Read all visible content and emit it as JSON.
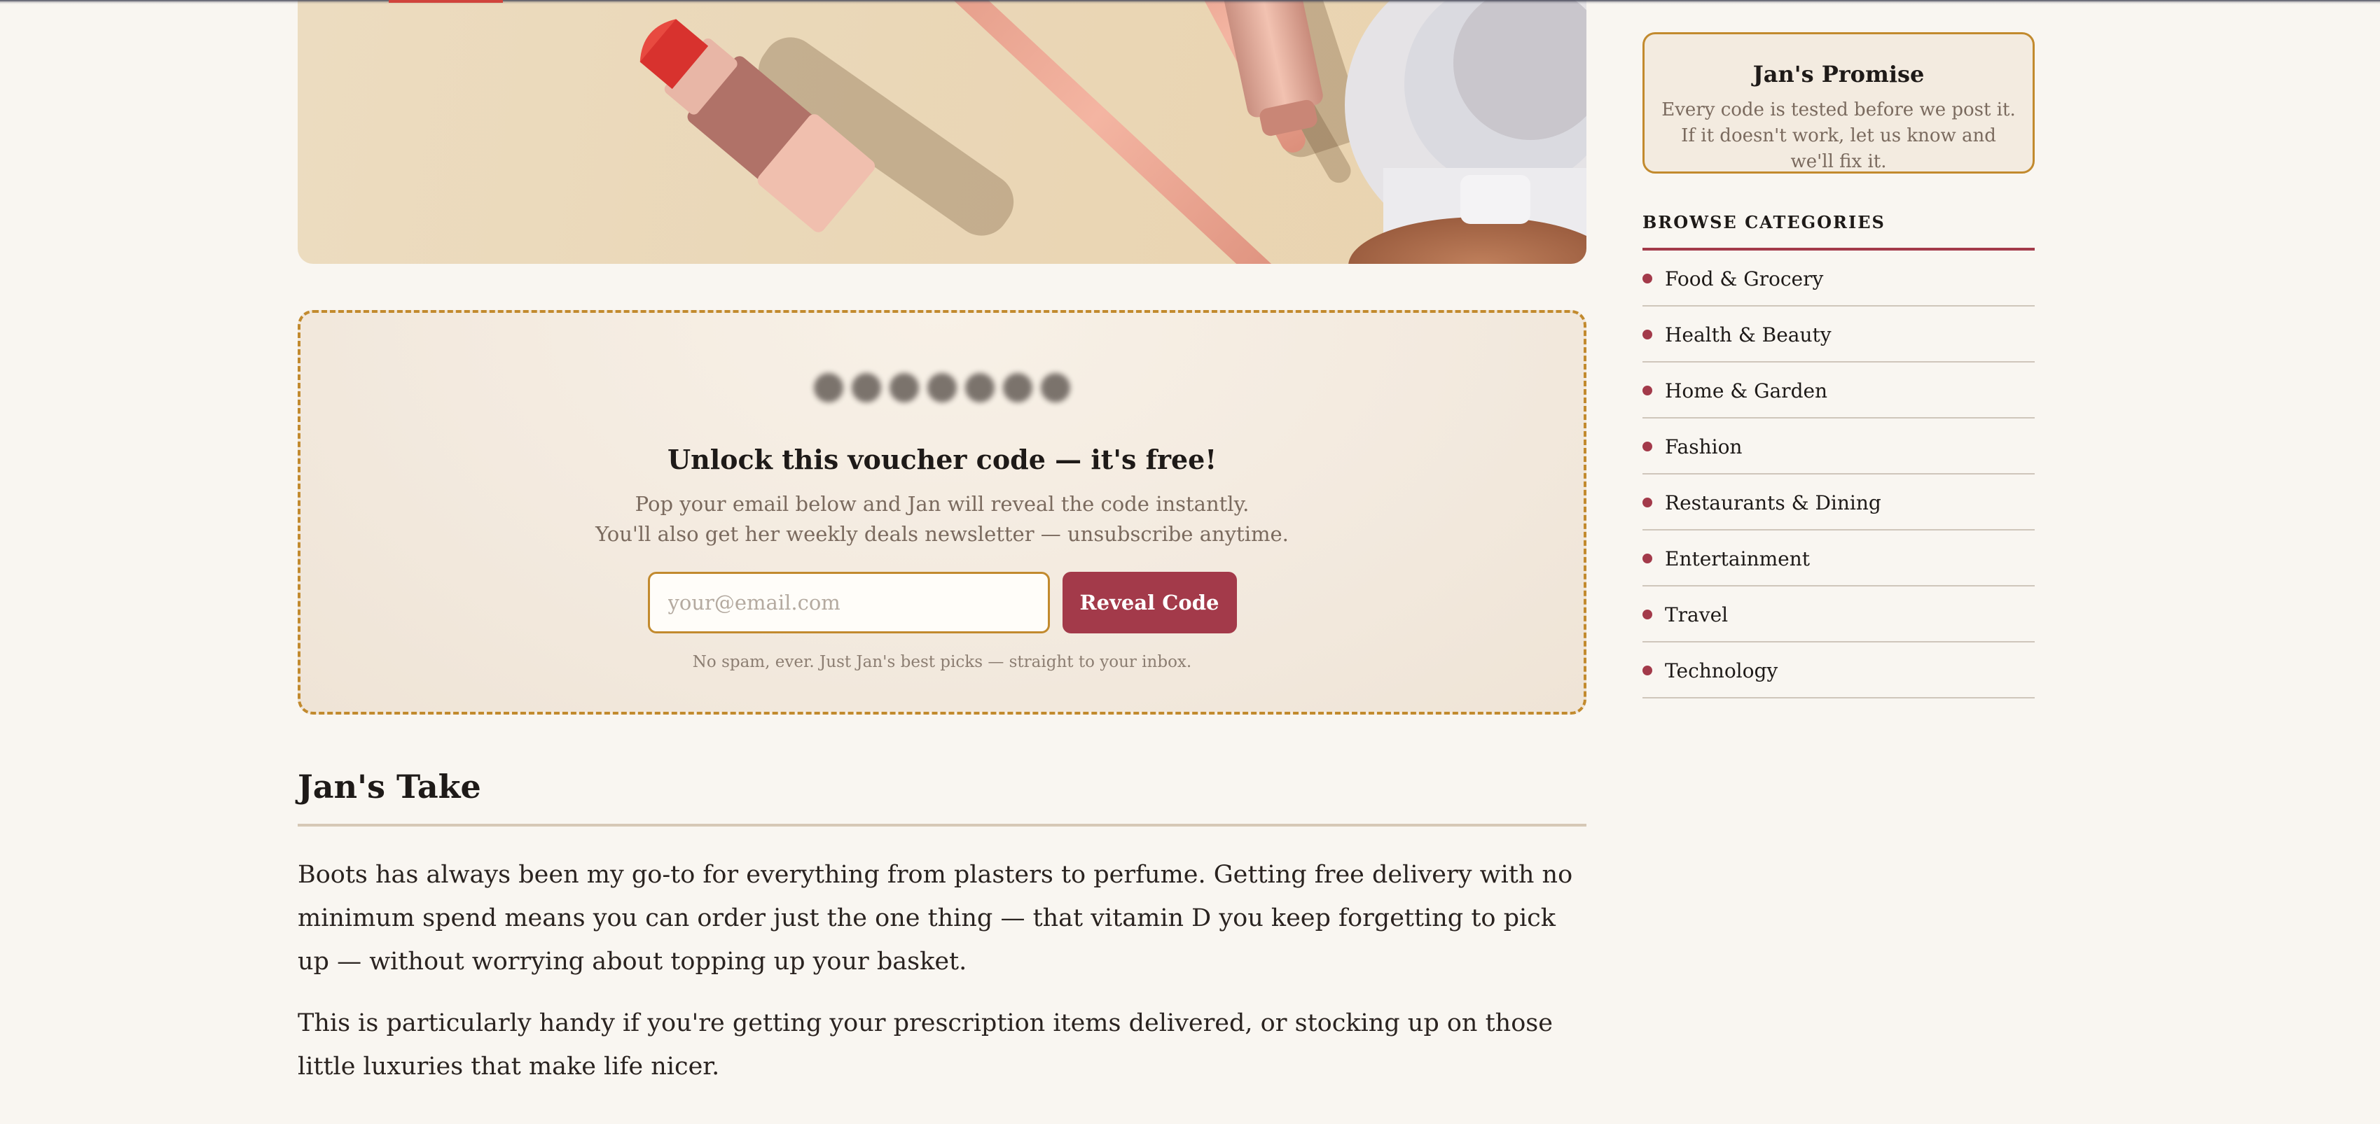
{
  "voucher": {
    "title": "Unlock this voucher code — it's free!",
    "subtitle_line1": "Pop your email below and Jan will reveal the code instantly.",
    "subtitle_line2": "You'll also get her weekly deals newsletter — unsubscribe anytime.",
    "email_placeholder": "your@email.com",
    "email_value": "",
    "button_label": "Reveal Code",
    "note": "No spam, ever. Just Jan's best picks — straight to your inbox."
  },
  "take": {
    "heading": "Jan's Take",
    "paragraphs": [
      "Boots has always been my go-to for everything from plasters to perfume. Getting free delivery with no minimum spend means you can order just the one thing — that vitamin D you keep forgetting to pick up — without worrying about topping up your basket.",
      "This is particularly handy if you're getting your prescription items delivered, or stocking up on those little luxuries that make life nicer."
    ]
  },
  "sidebar": {
    "promise_title": "Jan's Promise",
    "promise_text": "Every code is tested before we post it. If it doesn't work, let us know and we'll fix it.",
    "categories_heading": "BROWSE CATEGORIES",
    "categories": [
      "Food & Grocery",
      "Health & Beauty",
      "Home & Garden",
      "Fashion",
      "Restaurants & Dining",
      "Entertainment",
      "Travel",
      "Technology"
    ]
  },
  "colors": {
    "accent": "#a33a4a",
    "gold": "#c28a2e",
    "background": "#f9f6f1"
  }
}
